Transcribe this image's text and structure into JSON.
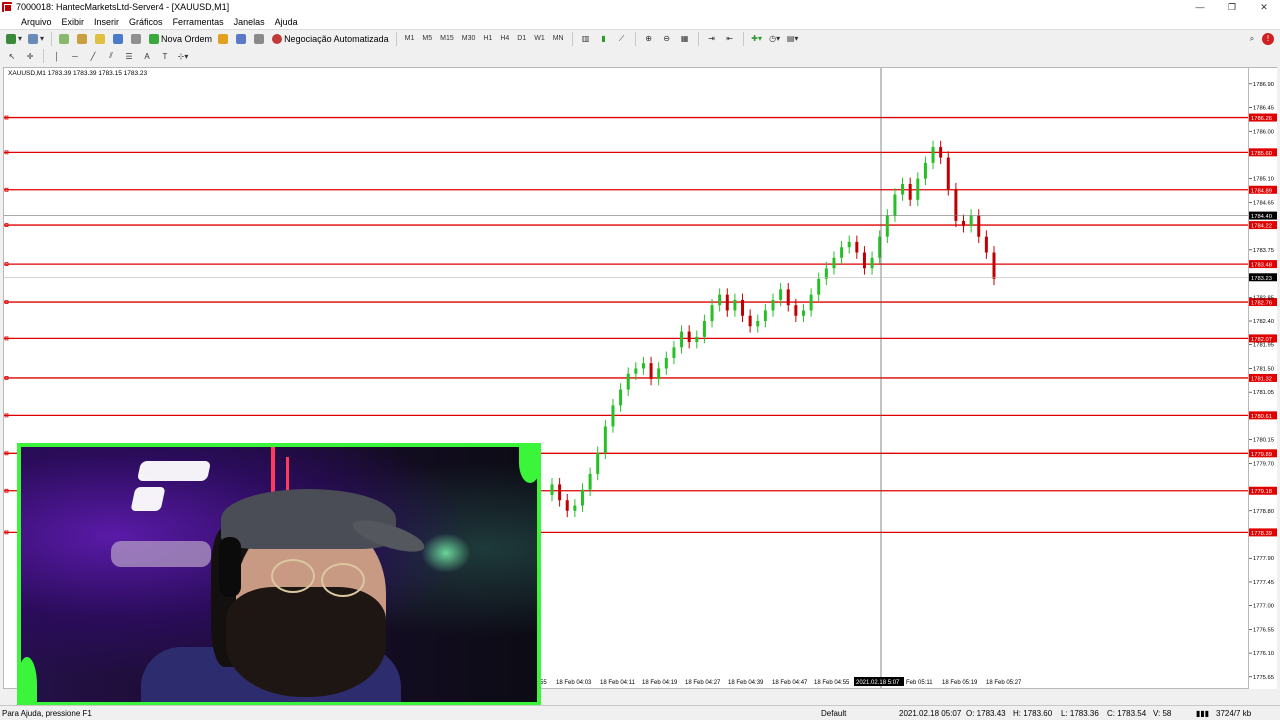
{
  "window": {
    "title": "7000018: HantecMarketsLtd-Server4 - [XAUUSD,M1]",
    "controls": [
      "—",
      "❐",
      "✕"
    ]
  },
  "menu": [
    "Arquivo",
    "Exibir",
    "Inserir",
    "Gráficos",
    "Ferramentas",
    "Janelas",
    "Ajuda"
  ],
  "toolbar": {
    "new_order": "Nova Ordem",
    "algo_trading": "Negociação Automatizada",
    "timeframes": [
      "M1",
      "M5",
      "M15",
      "M30",
      "H1",
      "H4",
      "D1",
      "W1",
      "MN"
    ]
  },
  "chart": {
    "symbol_info": "XAUUSD,M1  1783.39 1783.39 1783.15 1783.23",
    "crosshair_time": "2021.02.18 5:07",
    "accent": "#e00000",
    "bull_color": "#26c026",
    "bear_color": "#c00000"
  },
  "chart_data": {
    "type": "candlestick",
    "symbol": "XAUUSD",
    "timeframe": "M1",
    "ohlc_header": [
      1783.39,
      1783.39,
      1783.15,
      1783.23
    ],
    "current_price": 1783.23,
    "crosshair_price": 1784.4,
    "ylim": [
      1775.4,
      1787.2
    ],
    "price_ticks": [
      1786.9,
      1786.45,
      1786.0,
      1785.1,
      1784.65,
      1783.75,
      1782.85,
      1782.4,
      1781.95,
      1781.5,
      1781.05,
      1780.15,
      1779.7,
      1778.8,
      1777.9,
      1777.45,
      1777.0,
      1776.55,
      1776.1,
      1775.65
    ],
    "horizontal_lines": [
      1786.26,
      1785.6,
      1784.89,
      1784.22,
      1783.48,
      1782.76,
      1782.07,
      1781.32,
      1780.61,
      1779.89,
      1779.18,
      1778.39
    ],
    "time_ticks": [
      "55",
      "18 Feb 04:03",
      "18 Feb 04:11",
      "18 Feb 04:19",
      "18 Feb 04:27",
      "18 Feb 04:39",
      "18 Feb 04:47",
      "18 Feb 04:55",
      "Feb 05:11",
      "18 Feb 05:19",
      "18 Feb 05:27"
    ],
    "candles_close": [
      1779.3,
      1779.0,
      1778.8,
      1778.9,
      1779.2,
      1779.5,
      1779.9,
      1780.4,
      1780.8,
      1781.1,
      1781.4,
      1781.5,
      1781.6,
      1781.3,
      1781.5,
      1781.7,
      1781.9,
      1782.2,
      1782.0,
      1782.1,
      1782.4,
      1782.7,
      1782.9,
      1782.6,
      1782.8,
      1782.5,
      1782.3,
      1782.4,
      1782.6,
      1782.8,
      1783.0,
      1782.7,
      1782.5,
      1782.6,
      1782.9,
      1783.2,
      1783.4,
      1783.6,
      1783.8,
      1783.9,
      1783.7,
      1783.4,
      1783.6,
      1784.0,
      1784.4,
      1784.8,
      1785.0,
      1784.7,
      1785.1,
      1785.4,
      1785.7,
      1785.5,
      1784.9,
      1784.3,
      1784.2,
      1784.4,
      1784.0,
      1783.7,
      1783.2
    ]
  },
  "status": {
    "help": "Para Ajuda, pressione F1",
    "profile": "Default",
    "datetime": "2021.02.18 05:07",
    "open": "O: 1783.43",
    "high": "H: 1783.60",
    "low": "L: 1783.36",
    "close": "C: 1783.54",
    "volume": "V: 58",
    "traffic": "3724/7 kb"
  }
}
